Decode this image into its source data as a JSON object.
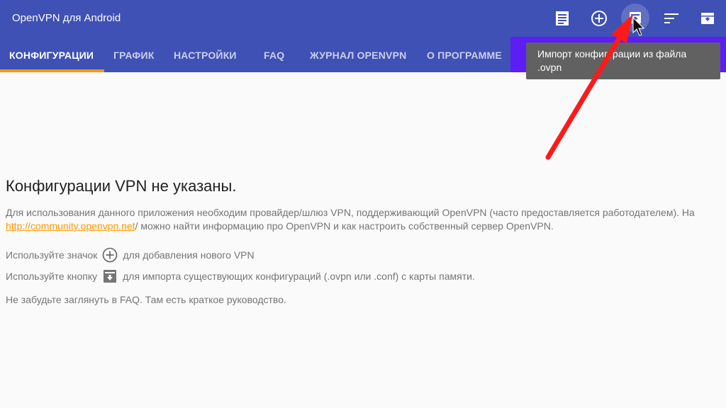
{
  "app": {
    "title": "OpenVPN для Android"
  },
  "toolbar": {
    "actions": [
      {
        "icon": "log-icon"
      },
      {
        "icon": "add-circle-icon"
      },
      {
        "icon": "import-icon"
      },
      {
        "icon": "sort-icon"
      },
      {
        "icon": "archive-icon"
      }
    ]
  },
  "tabs": [
    {
      "label": "КОНФИГУРАЦИИ",
      "active": true
    },
    {
      "label": "ГРАФИК"
    },
    {
      "label": "НАСТРОЙКИ"
    },
    {
      "label": "FAQ"
    },
    {
      "label": "ЖУРНАЛ OPENVPN"
    },
    {
      "label": "О ПРОГРАММЕ"
    }
  ],
  "tooltip": {
    "text": "Импорт конфигурации из файла .ovpn"
  },
  "content": {
    "title": "Конфигурации VPN не указаны.",
    "intro_before": "Для использования данного приложения необходим провайдер/шлюз VPN, поддерживающий OpenVPN (часто предоставляется работодателем). На ",
    "intro_link": "http://community.openvpn.net",
    "intro_after": "/ можно найти информацию про OpenVPN и как настроить собственный сервер OpenVPN.",
    "add_hint_before": "Используйте значок",
    "add_hint_after": "для добавления нового VPN",
    "import_hint_before": "Используйте кнопку",
    "import_hint_after": "для импорта существующих конфигураций (.ovpn или .conf) с карты памяти.",
    "faq_hint": "Не забудьте заглянуть в FAQ. Там есть краткое руководство."
  },
  "colors": {
    "primary": "#3f51b5",
    "accent": "#ff9800",
    "highlight": "#5d1df5",
    "annotation_arrow": "#ff1a1a"
  }
}
